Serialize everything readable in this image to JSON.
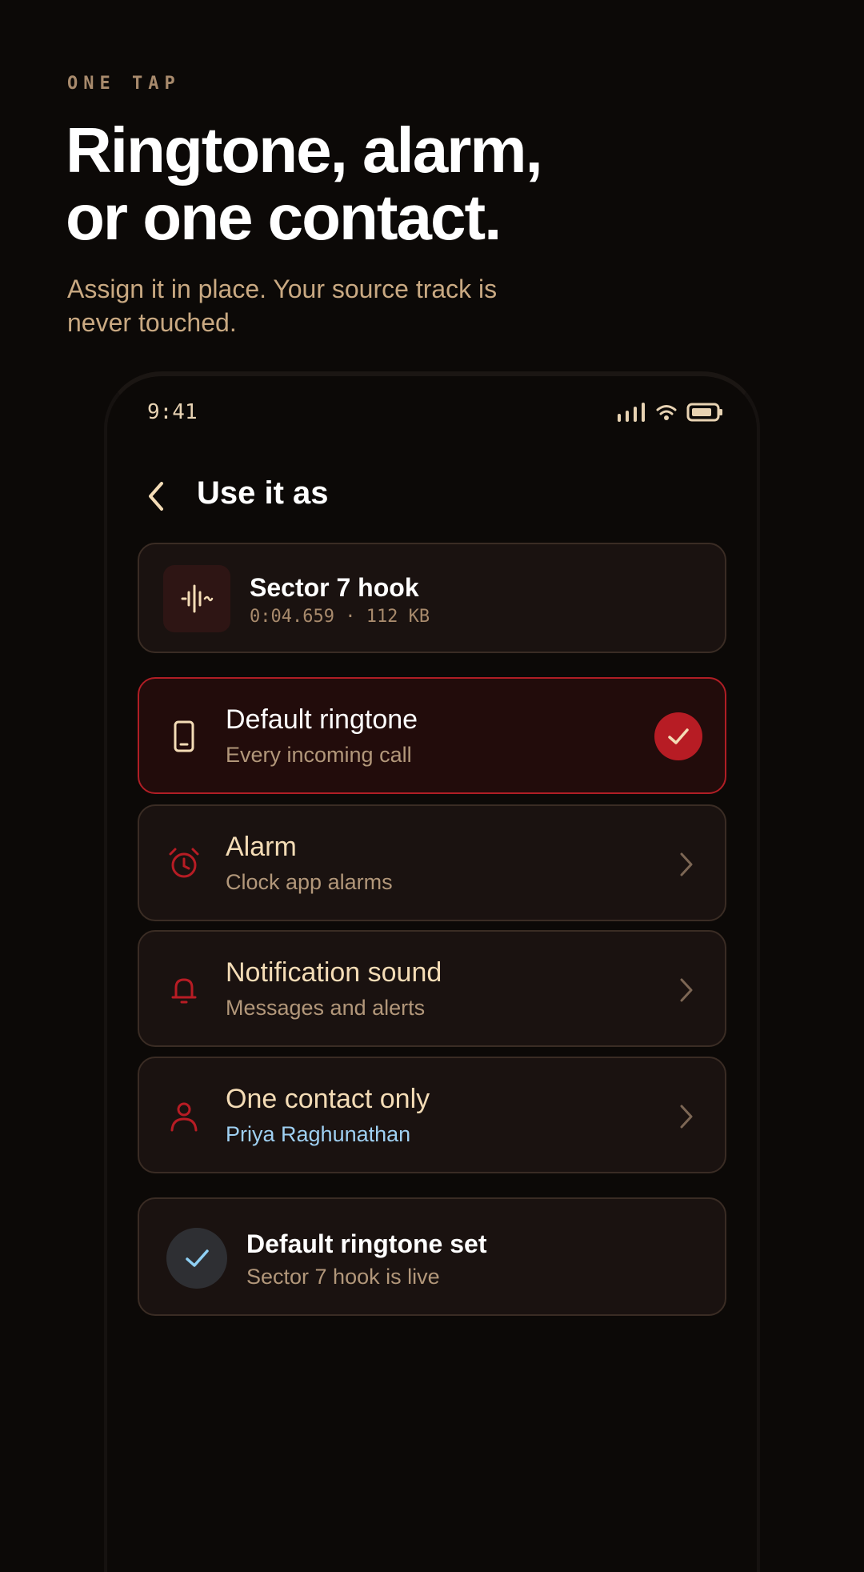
{
  "intro": {
    "eyebrow": "ONE TAP",
    "headline_line1": "Ringtone, alarm,",
    "headline_line2": "or one contact.",
    "subhead": "Assign it in place. Your source track is never touched."
  },
  "status_bar": {
    "time": "9:41",
    "icons": [
      "signal-icon",
      "wifi-icon",
      "battery-icon"
    ]
  },
  "screen": {
    "title": "Use it as",
    "back_icon": "chevron-left-icon"
  },
  "track": {
    "title": "Sector 7 hook",
    "meta": "0:04.659 · 112 KB",
    "icon": "waveform-icon"
  },
  "options": [
    {
      "title": "Default ringtone",
      "subtitle": "Every incoming call",
      "icon": "phone-icon",
      "selected": true
    },
    {
      "title": "Alarm",
      "subtitle": "Clock app alarms",
      "icon": "alarm-clock-icon",
      "selected": false
    },
    {
      "title": "Notification sound",
      "subtitle": "Messages and alerts",
      "icon": "bell-icon",
      "selected": false
    },
    {
      "title": "One contact only",
      "subtitle": "Priya Raghunathan",
      "icon": "person-icon",
      "selected": false
    }
  ],
  "confirmation": {
    "title": "Default ringtone set",
    "subtitle": "Sector 7 hook is live"
  },
  "colors": {
    "background": "#0c0907",
    "accent_red": "#b71c24",
    "card": "#1a1210",
    "muted_text": "#b2977a",
    "contact_blue": "#9fd0f2",
    "confirm_check": "#8fd0f4"
  }
}
